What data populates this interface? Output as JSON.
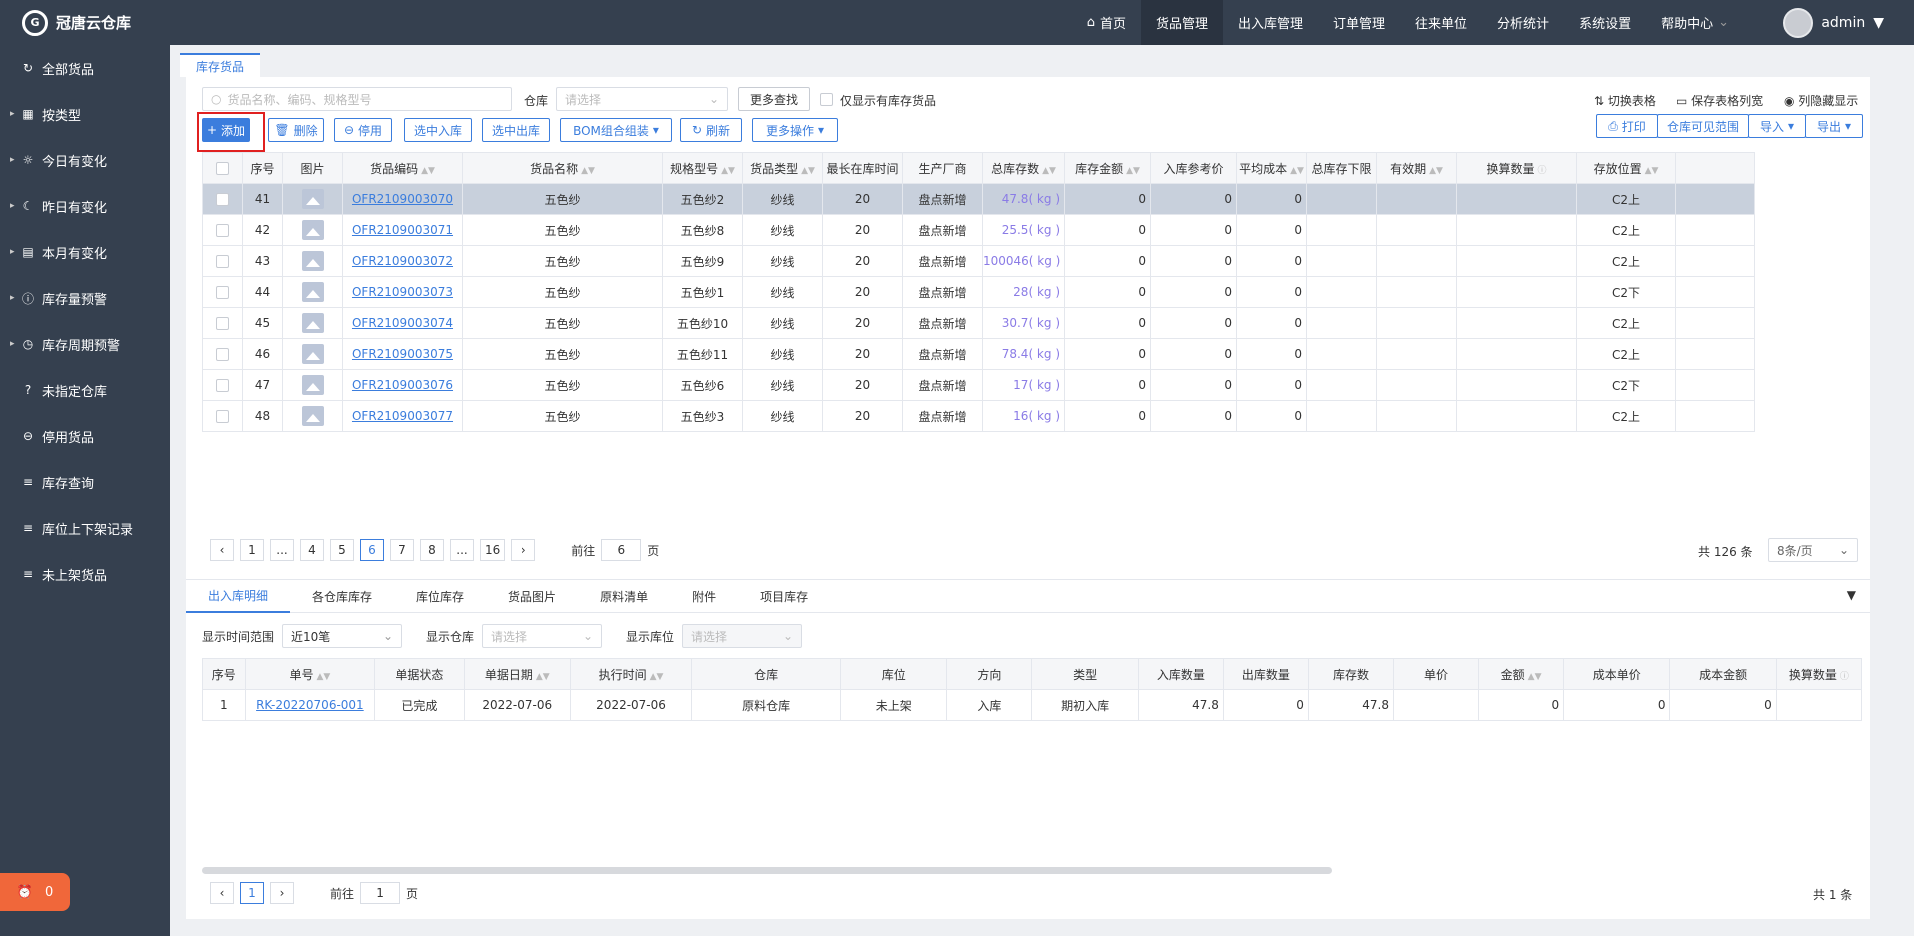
{
  "app": {
    "logo_text": "冠唐云仓库"
  },
  "sidebar": {
    "items": [
      {
        "label": "全部货品",
        "icon": "refresh-icon",
        "arrow": false
      },
      {
        "label": "按类型",
        "icon": "grid-icon",
        "arrow": true
      },
      {
        "label": "今日有变化",
        "icon": "sun-icon",
        "arrow": true
      },
      {
        "label": "昨日有变化",
        "icon": "moon-icon",
        "arrow": true
      },
      {
        "label": "本月有变化",
        "icon": "calendar-icon",
        "arrow": true
      },
      {
        "label": "库存量预警",
        "icon": "alert-icon",
        "arrow": true
      },
      {
        "label": "库存周期预警",
        "icon": "clock-icon",
        "arrow": true
      },
      {
        "label": "未指定仓库",
        "icon": "question-icon",
        "arrow": false
      },
      {
        "label": "停用货品",
        "icon": "minus-circle-icon",
        "arrow": false
      },
      {
        "label": "库存查询",
        "icon": "list-icon",
        "arrow": false
      },
      {
        "label": "库位上下架记录",
        "icon": "list-icon",
        "arrow": false
      },
      {
        "label": "未上架货品",
        "icon": "list-icon",
        "arrow": false
      }
    ],
    "alarm_count": "0"
  },
  "topnav": {
    "items": [
      "首页",
      "货品管理",
      "出入库管理",
      "订单管理",
      "往来单位",
      "分析统计",
      "系统设置",
      "帮助中心"
    ],
    "user": "admin"
  },
  "page_tab": "库存货品",
  "toolbar": {
    "search_placeholder": "货品名称、编码、规格型号",
    "warehouse_label": "仓库",
    "warehouse_placeholder": "请选择",
    "more_search": "更多查找",
    "only_stock": "仅显示有库存货品",
    "switch_table": "切换表格",
    "save_width": "保存表格列宽",
    "toggle_cols": "列隐藏显示",
    "add": "添加",
    "delete": "删除",
    "disable": "停用",
    "sel_in": "选中入库",
    "sel_out": "选中出库",
    "bom": "BOM组合组装",
    "refresh": "刷新",
    "more_ops": "更多操作",
    "print": "打印",
    "visible_range": "仓库可见范围",
    "import": "导入",
    "export": "导出"
  },
  "table": {
    "headers": [
      "序号",
      "图片",
      "货品编码",
      "货品名称",
      "规格型号",
      "货品类型",
      "最长在库时间",
      "生产厂商",
      "总库存数",
      "库存金额",
      "入库参考价",
      "平均成本",
      "总库存下限",
      "有效期",
      "换算数量",
      "存放位置"
    ],
    "rows": [
      {
        "no": "41",
        "code": "OFR2109003070",
        "name": "五色纱",
        "spec": "五色纱2",
        "type": "纱线",
        "days": "20",
        "maker": "盘点新增",
        "stock": "47.8( kg )",
        "amount": "0",
        "ref": "0",
        "avg": "0",
        "low": "",
        "exp": "",
        "conv": "",
        "loc": "C2上"
      },
      {
        "no": "42",
        "code": "OFR2109003071",
        "name": "五色纱",
        "spec": "五色纱8",
        "type": "纱线",
        "days": "20",
        "maker": "盘点新增",
        "stock": "25.5( kg )",
        "amount": "0",
        "ref": "0",
        "avg": "0",
        "low": "",
        "exp": "",
        "conv": "",
        "loc": "C2上"
      },
      {
        "no": "43",
        "code": "OFR2109003072",
        "name": "五色纱",
        "spec": "五色纱9",
        "type": "纱线",
        "days": "20",
        "maker": "盘点新增",
        "stock": "100046( kg )",
        "amount": "0",
        "ref": "0",
        "avg": "0",
        "low": "",
        "exp": "",
        "conv": "",
        "loc": "C2上"
      },
      {
        "no": "44",
        "code": "OFR2109003073",
        "name": "五色纱",
        "spec": "五色纱1",
        "type": "纱线",
        "days": "20",
        "maker": "盘点新增",
        "stock": "28( kg )",
        "amount": "0",
        "ref": "0",
        "avg": "0",
        "low": "",
        "exp": "",
        "conv": "",
        "loc": "C2下"
      },
      {
        "no": "45",
        "code": "OFR2109003074",
        "name": "五色纱",
        "spec": "五色纱10",
        "type": "纱线",
        "days": "20",
        "maker": "盘点新增",
        "stock": "30.7( kg )",
        "amount": "0",
        "ref": "0",
        "avg": "0",
        "low": "",
        "exp": "",
        "conv": "",
        "loc": "C2上"
      },
      {
        "no": "46",
        "code": "OFR2109003075",
        "name": "五色纱",
        "spec": "五色纱11",
        "type": "纱线",
        "days": "20",
        "maker": "盘点新增",
        "stock": "78.4( kg )",
        "amount": "0",
        "ref": "0",
        "avg": "0",
        "low": "",
        "exp": "",
        "conv": "",
        "loc": "C2上"
      },
      {
        "no": "47",
        "code": "OFR2109003076",
        "name": "五色纱",
        "spec": "五色纱6",
        "type": "纱线",
        "days": "20",
        "maker": "盘点新增",
        "stock": "17( kg )",
        "amount": "0",
        "ref": "0",
        "avg": "0",
        "low": "",
        "exp": "",
        "conv": "",
        "loc": "C2下"
      },
      {
        "no": "48",
        "code": "OFR2109003077",
        "name": "五色纱",
        "spec": "五色纱3",
        "type": "纱线",
        "days": "20",
        "maker": "盘点新增",
        "stock": "16( kg )",
        "amount": "0",
        "ref": "0",
        "avg": "0",
        "low": "",
        "exp": "",
        "conv": "",
        "loc": "C2上"
      }
    ]
  },
  "pager": {
    "pages": [
      "1",
      "...",
      "4",
      "5",
      "6",
      "7",
      "8",
      "...",
      "16"
    ],
    "current": "6",
    "goto_label": "前往",
    "goto_value": "6",
    "page_unit": "页",
    "total": "共 126 条",
    "page_size": "8条/页"
  },
  "lower": {
    "tabs": [
      "出入库明细",
      "各仓库库存",
      "库位库存",
      "货品图片",
      "原料清单",
      "附件",
      "项目库存"
    ],
    "range_label": "显示时间范围",
    "range_value": "近10笔",
    "wh_label": "显示仓库",
    "wh_placeholder": "请选择",
    "loc_label": "显示库位",
    "loc_placeholder": "请选择",
    "headers": [
      "序号",
      "单号",
      "单据状态",
      "单据日期",
      "执行时间",
      "仓库",
      "库位",
      "方向",
      "类型",
      "入库数量",
      "出库数量",
      "库存数",
      "单价",
      "金额",
      "成本单价",
      "成本金额",
      "换算数量"
    ],
    "rows": [
      {
        "no": "1",
        "doc": "RK-20220706-001",
        "status": "已完成",
        "date": "2022-07-06",
        "exec": "2022-07-06",
        "wh": "原料仓库",
        "loc": "未上架",
        "dir": "入库",
        "type": "期初入库",
        "in": "47.8",
        "out": "0",
        "stock": "47.8",
        "price": "",
        "amount": "0",
        "cost": "0",
        "costamt": "0",
        "conv": ""
      }
    ],
    "pager": {
      "current": "1",
      "goto_label": "前往",
      "goto_value": "1",
      "page_unit": "页",
      "total": "共 1 条"
    }
  }
}
